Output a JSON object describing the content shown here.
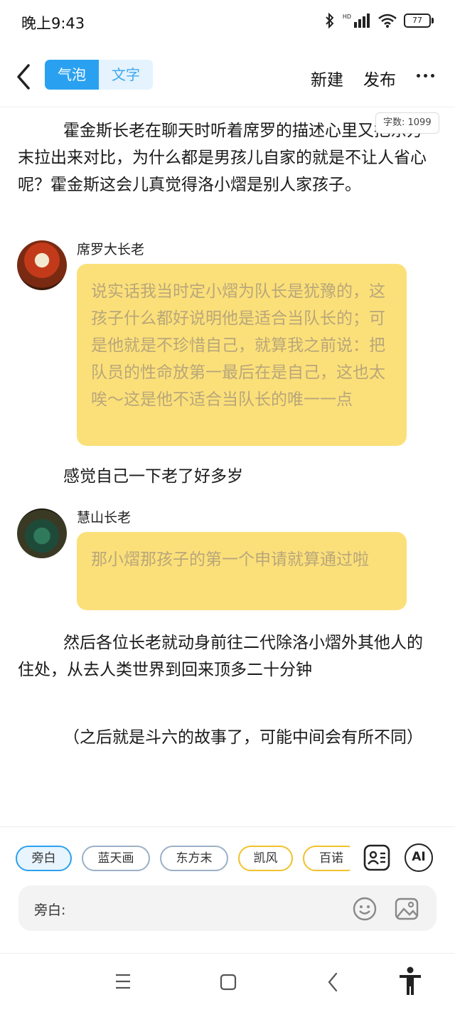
{
  "status": {
    "time": "晚上9:43",
    "battery": "77",
    "network": "HD"
  },
  "toolbar": {
    "tab_bubble": "气泡",
    "tab_text": "文字",
    "new_label": "新建",
    "publish_label": "发布"
  },
  "word_count": "字数: 1099",
  "story": {
    "para1": "霍金斯长老在聊天时听着席罗的描述心里又把东方末拉出来对比，为什么都是男孩儿自家的就是不让人省心呢？霍金斯这会儿真觉得洛小熠是别人家孩子。",
    "msg1_name": "席罗大长老",
    "msg1_text": "说实话我当时定小熠为队长是犹豫的，这孩子什么都好说明他是适合当队长的；可是他就是不珍惜自己，就算我之前说：把队员的性命放第一最后在是自己，这也太唉～这是他不适合当队长的唯一一点",
    "line2": "感觉自己一下老了好多岁",
    "msg2_name": "慧山长老",
    "msg2_text": "那小熠那孩子的第一个申请就算通过啦",
    "para3": "然后各位长老就动身前往二代除洛小熠外其他人的住处，从去人类世界到回来顶多二十分钟",
    "para4": "（之后就是斗六的故事了，可能中间会有所不同）"
  },
  "characters": [
    "旁白",
    "蓝天画",
    "东方末",
    "凯风",
    "百诺"
  ],
  "ai_label": "AI",
  "input": {
    "label": "旁白:"
  },
  "colors": {
    "accent": "#2aa1f0",
    "bubble": "#fbe07a",
    "gold_chip": "#f0c22a"
  },
  "icons": [
    "back-icon",
    "more-icon",
    "contacts-icon",
    "ai-icon",
    "emoji-icon",
    "image-icon",
    "menu-icon",
    "home-icon",
    "nav-back-icon",
    "accessibility-icon"
  ]
}
